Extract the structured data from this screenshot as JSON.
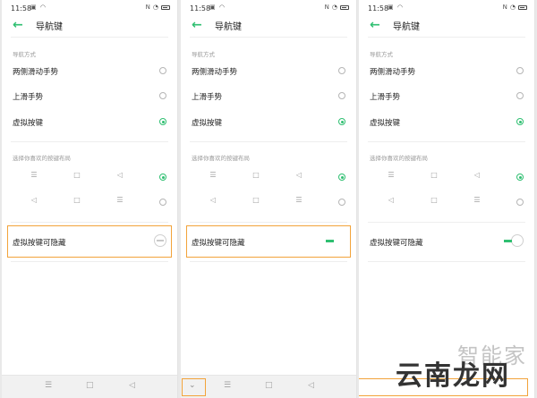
{
  "status_time": "11:58",
  "page_title": "导航键",
  "nav_mode_label": "导航方式",
  "options": [
    "两侧滑动手势",
    "上滑手势",
    "虚拟按键"
  ],
  "layout_label": "选择你喜欢的按键布局",
  "layout1": [
    "☰",
    "□",
    "◁"
  ],
  "layout2": [
    "◁",
    "□",
    "☰"
  ],
  "hide_toggle_label": "虚拟按键可隐藏",
  "navbar_keys": [
    "☰",
    "□",
    "◁"
  ],
  "collapse_key": "⌄",
  "watermark": {
    "top": "智能家",
    "bottom": "云南龙网"
  },
  "accent_color": "#2fbf71",
  "highlight_color": "#f2a33a",
  "icons": {
    "back": "back-arrow-icon",
    "nfc": "nfc-icon",
    "wifi": "wifi-icon",
    "battery": "battery-icon"
  }
}
